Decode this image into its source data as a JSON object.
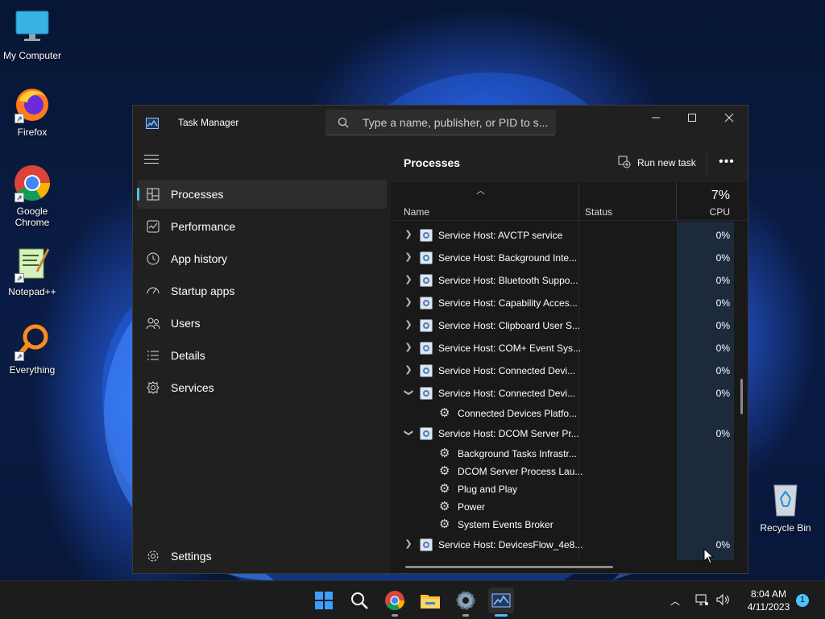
{
  "desktop": {
    "icons": [
      {
        "label": "My Computer",
        "icon": "monitor-icon"
      },
      {
        "label": "Firefox",
        "icon": "firefox-icon"
      },
      {
        "label": "Google Chrome",
        "icon": "chrome-icon"
      },
      {
        "label": "Notepad++",
        "icon": "notepadpp-icon"
      },
      {
        "label": "Everything",
        "icon": "everything-icon"
      },
      {
        "label": "Recycle Bin",
        "icon": "recycle-bin-icon"
      }
    ]
  },
  "window": {
    "title": "Task Manager",
    "search_placeholder": "Type a name, publisher, or PID to s..."
  },
  "sidebar": {
    "items": [
      {
        "label": "Processes",
        "icon": "processes-icon",
        "active": true
      },
      {
        "label": "Performance",
        "icon": "performance-icon"
      },
      {
        "label": "App history",
        "icon": "app-history-icon"
      },
      {
        "label": "Startup apps",
        "icon": "startup-apps-icon"
      },
      {
        "label": "Users",
        "icon": "users-icon"
      },
      {
        "label": "Details",
        "icon": "details-icon"
      },
      {
        "label": "Services",
        "icon": "services-icon"
      }
    ],
    "settings_label": "Settings"
  },
  "content": {
    "title": "Processes",
    "run_new_task_label": "Run new task",
    "more_label": "•••",
    "columns": {
      "name": "Name",
      "status": "Status",
      "cpu_total": "7%",
      "cpu": "CPU"
    },
    "rows": [
      {
        "name": "Service Host: AVCTP service",
        "cpu": "0%",
        "expanded": false
      },
      {
        "name": "Service Host: Background Inte...",
        "cpu": "0%",
        "expanded": false
      },
      {
        "name": "Service Host: Bluetooth Suppo...",
        "cpu": "0%",
        "expanded": false
      },
      {
        "name": "Service Host: Capability Acces...",
        "cpu": "0%",
        "expanded": false
      },
      {
        "name": "Service Host: Clipboard User S...",
        "cpu": "0%",
        "expanded": false
      },
      {
        "name": "Service Host: COM+ Event Sys...",
        "cpu": "0%",
        "expanded": false
      },
      {
        "name": "Service Host: Connected Devi...",
        "cpu": "0%",
        "expanded": false
      },
      {
        "name": "Service Host: Connected Devi...",
        "cpu": "0%",
        "expanded": true,
        "children": [
          "Connected Devices Platfo..."
        ]
      },
      {
        "name": "Service Host: DCOM Server Pr...",
        "cpu": "0%",
        "expanded": true,
        "children": [
          "Background Tasks Infrastr...",
          "DCOM Server Process Lau...",
          "Plug and Play",
          "Power",
          "System Events Broker"
        ]
      },
      {
        "name": "Service Host: DevicesFlow_4e8...",
        "cpu": "0%",
        "expanded": false
      }
    ]
  },
  "taskbar": {
    "apps": [
      "start-icon",
      "search-icon",
      "chrome-icon",
      "file-explorer-icon",
      "settings-icon",
      "task-manager-icon"
    ],
    "time": "8:04 AM",
    "date": "4/11/2023",
    "notification_count": "1"
  },
  "colors": {
    "accent": "#4cc2ff",
    "window_bg": "#202020",
    "content_bg": "#191919",
    "cpu_column_bg": "#1d2a3c"
  }
}
